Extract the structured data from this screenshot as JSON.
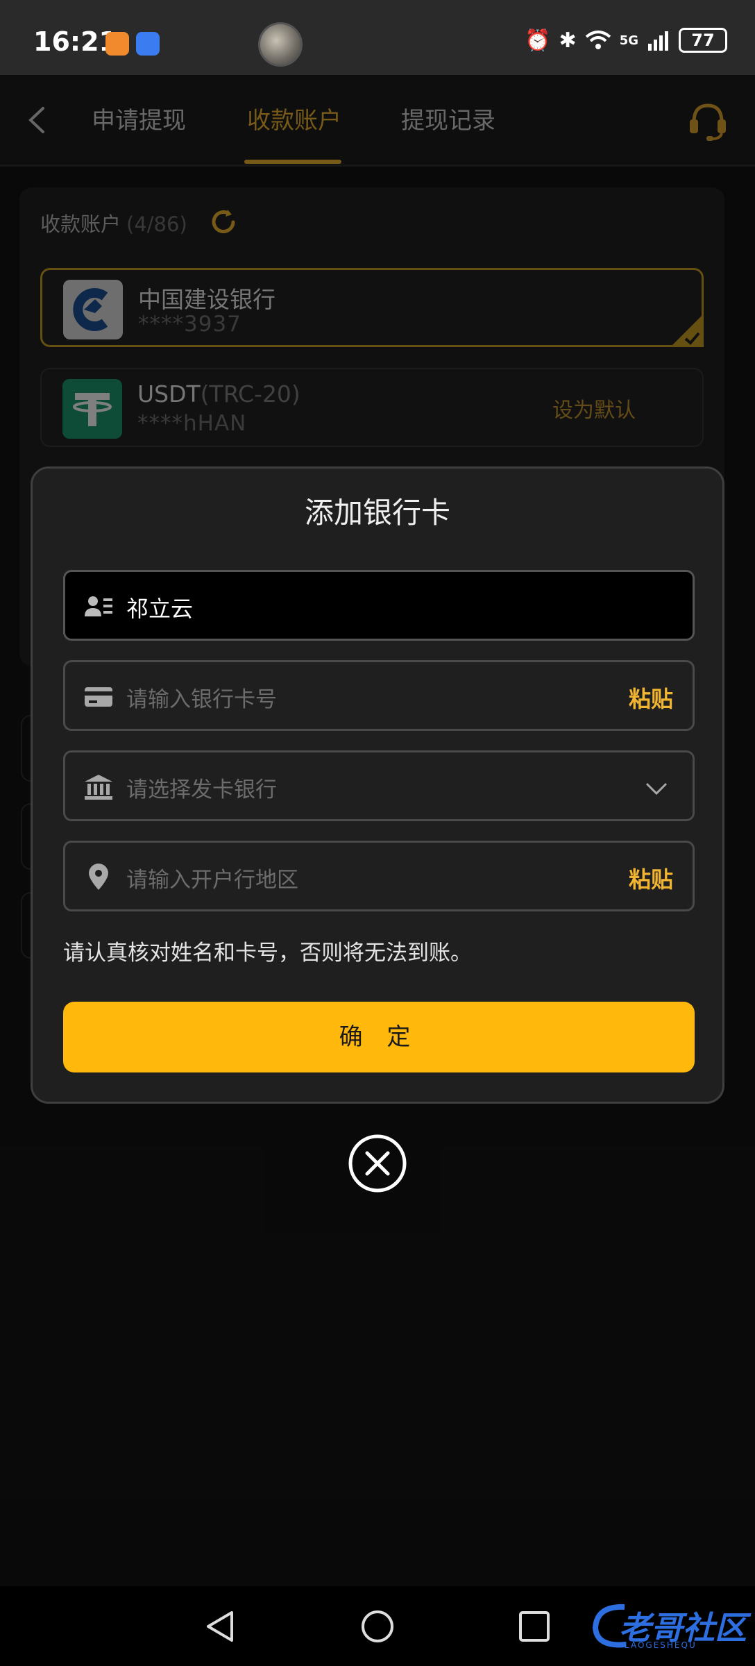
{
  "status_bar": {
    "time": "16:21",
    "battery": "77",
    "network": "5G"
  },
  "header": {
    "tabs": [
      {
        "label": "申请提现"
      },
      {
        "label": "收款账户"
      },
      {
        "label": "提现记录"
      }
    ],
    "active_tab": "收款账户"
  },
  "accounts_card": {
    "title": "收款账户",
    "count": "(4/86)",
    "accounts": [
      {
        "name": "中国建设银行",
        "name_suffix": "",
        "number": "****3937",
        "selected": true
      },
      {
        "name": "USDT",
        "name_suffix": "(TRC-20)",
        "number": "****hHAN",
        "action": "设为默认"
      }
    ]
  },
  "modal": {
    "title": "添加银行卡",
    "name_value": "祁立云",
    "card_number_placeholder": "请输入银行卡号",
    "bank_placeholder": "请选择发卡银行",
    "region_placeholder": "请输入开户行地区",
    "paste_label": "粘贴",
    "notice": "请认真核对姓名和卡号，否则将无法到账。",
    "confirm_label": "确 定"
  },
  "watermark": {
    "text": "老哥社区",
    "sub": "LAOGESHEQU"
  },
  "colors": {
    "accent": "#d9a52d",
    "button": "#ffb80b",
    "paste": "#f1b531"
  }
}
